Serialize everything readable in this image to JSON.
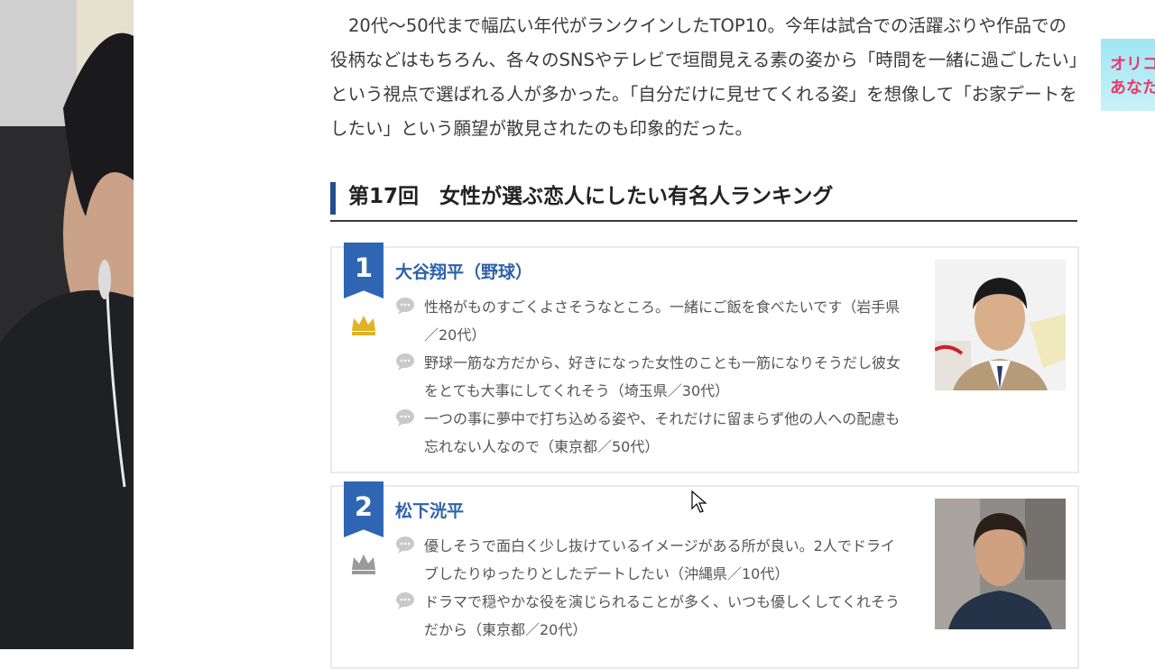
{
  "article": {
    "intro": "20代～50代まで幅広い年代がランクインしたTOP10。今年は試合での活躍ぶりや作品での役柄などはもちろん、各々のSNSやテレビで垣間見える素の姿から「時間を一緒に過ごしたい」という視点で選ばれる人が多かった。「自分だけに見せてくれる姿」を想像して「お家デートをしたい」という願望が散見されたのも印象的だった。",
    "heading": "第17回　女性が選ぶ恋人にしたい有名人ランキング"
  },
  "ranking": [
    {
      "rank": "1",
      "name": "大谷翔平（野球）",
      "crown_color": "#e0b324",
      "comments": [
        "性格がものすごくよさそうなところ。一緒にご飯を食べたいです（岩手県／20代）",
        "野球一筋な方だから、好きになった女性のことも一筋になりそうだし彼女をとても大事にしてくれそう（埼玉県／30代）",
        "一つの事に夢中で打ち込める姿や、それだけに留まらず他の人への配慮も忘れない人なので（東京都／50代）"
      ]
    },
    {
      "rank": "2",
      "name": "松下洸平",
      "crown_color": "#9a9a9a",
      "comments": [
        "優しそうで面白く少し抜けているイメージがある所が良い。2人でドライブしたりゆったりとしたデートしたい（沖縄県／10代）",
        "ドラマで穏やかな役を演じられることが多く、いつも優しくしてくれそうだから（東京都／20代）"
      ]
    }
  ],
  "banner": {
    "line1": "オリコ",
    "line2": "あなた"
  },
  "colors": {
    "accent": "#2f66b3",
    "heading_bar": "#214e8a"
  }
}
